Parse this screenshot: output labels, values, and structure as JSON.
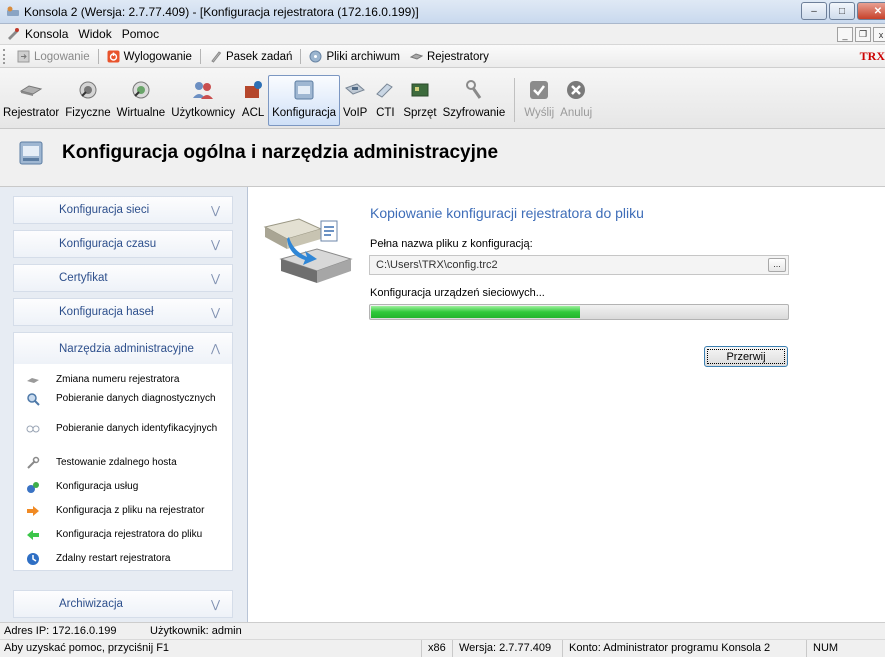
{
  "window": {
    "title": "Konsola 2 (Wersja: 2.7.77.409) - [Konfiguracja rejestratora (172.16.0.199)]",
    "controls": {
      "minimize": "–",
      "maximize": "□",
      "close": "✕"
    }
  },
  "menubar": {
    "items": [
      "Konsola",
      "Widok",
      "Pomoc"
    ],
    "mdi": {
      "minimize": "_",
      "restore": "❐",
      "close": "x"
    }
  },
  "quickbar": {
    "items": [
      {
        "label": "Logowanie",
        "icon": "login-icon",
        "enabled": false
      },
      {
        "label": "Wylogowanie",
        "icon": "logout-icon",
        "enabled": true
      },
      {
        "label": "Pasek zadań",
        "icon": "taskbar-icon",
        "enabled": true
      },
      {
        "label": "Pliki archiwum",
        "icon": "archive-files-icon",
        "enabled": true
      },
      {
        "label": "Rejestratory",
        "icon": "recorders-icon",
        "enabled": true
      }
    ],
    "logo": "TRX"
  },
  "toolbar": {
    "items": [
      {
        "label": "Rejestrator",
        "icon": "recorder-icon",
        "active": false,
        "enabled": true
      },
      {
        "label": "Fizyczne",
        "icon": "physical-icon",
        "active": false,
        "enabled": true
      },
      {
        "label": "Wirtualne",
        "icon": "virtual-icon",
        "active": false,
        "enabled": true
      },
      {
        "label": "Użytkownicy",
        "icon": "users-icon",
        "active": false,
        "enabled": true
      },
      {
        "label": "ACL",
        "icon": "acl-icon",
        "active": false,
        "enabled": true
      },
      {
        "label": "Konfiguracja",
        "icon": "configuration-icon",
        "active": true,
        "enabled": true
      },
      {
        "label": "VoIP",
        "icon": "voip-icon",
        "active": false,
        "enabled": true
      },
      {
        "label": "CTI",
        "icon": "cti-icon",
        "active": false,
        "enabled": true
      },
      {
        "label": "Sprzęt",
        "icon": "hardware-icon",
        "active": false,
        "enabled": true
      },
      {
        "label": "Szyfrowanie",
        "icon": "encryption-icon",
        "active": false,
        "enabled": true
      },
      {
        "label": "Wyślij",
        "icon": "send-icon",
        "active": false,
        "enabled": false
      },
      {
        "label": "Anuluj",
        "icon": "cancel-icon",
        "active": false,
        "enabled": false
      }
    ]
  },
  "page": {
    "title": "Konfiguracja ogólna i narzędzia administracyjne"
  },
  "sidebar": {
    "sections": [
      {
        "label": "Konfiguracja sieci",
        "expanded": false
      },
      {
        "label": "Konfiguracja czasu",
        "expanded": false
      },
      {
        "label": "Certyfikat",
        "expanded": false
      },
      {
        "label": "Konfiguracja haseł",
        "expanded": false
      },
      {
        "label": "Narzędzia administracyjne",
        "expanded": true
      },
      {
        "label": "Archiwizacja",
        "expanded": false
      }
    ],
    "tools": [
      {
        "label": "Zmiana numeru rejestratora",
        "icon": "renumber-icon"
      },
      {
        "label": "Pobieranie danych diagnostycznych",
        "icon": "diagnostics-icon"
      },
      {
        "label": "Pobieranie danych identyfikacyjnych",
        "icon": "identification-icon"
      },
      {
        "label": "Testowanie zdalnego hosta",
        "icon": "remote-test-icon"
      },
      {
        "label": "Konfiguracja usług",
        "icon": "services-icon"
      },
      {
        "label": "Konfiguracja z pliku na rejestrator",
        "icon": "arrow-right-icon"
      },
      {
        "label": "Konfiguracja rejestratora do pliku",
        "icon": "arrow-left-icon"
      },
      {
        "label": "Zdalny restart rejestratora",
        "icon": "restart-icon"
      }
    ]
  },
  "content": {
    "section_title": "Kopiowanie konfiguracji rejestratora do pliku",
    "file_label": "Pełna nazwa pliku z konfiguracją:",
    "file_value": "C:\\Users\\TRX\\config.trc2",
    "browse_label": "...",
    "progress_label": "Konfiguracja urządzeń sieciowych...",
    "progress_fraction": 0.5,
    "stop_button": "Przerwij"
  },
  "status": {
    "ip": "Adres IP: 172.16.0.199",
    "user": "Użytkownik: admin",
    "help": "Aby uzyskać pomoc, przyciśnij F1",
    "arch": "x86",
    "version": "Wersja: 2.7.77.409",
    "account": "Konto: Administrator programu Konsola 2",
    "numlock": "NUM"
  },
  "colors": {
    "accent": "#3e6db8",
    "progress": "#2fc93a",
    "sidebar_bg": "#e7ecf3"
  }
}
